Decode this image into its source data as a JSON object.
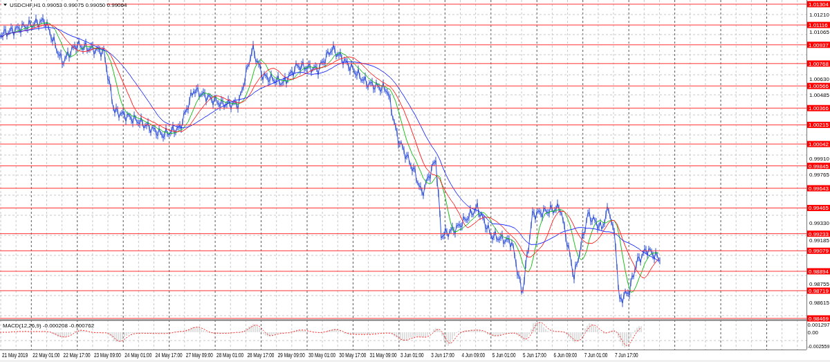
{
  "header": {
    "symbol": "USDCHF,H1",
    "quotes": [
      "0.99053",
      "0.99075",
      "0.99050",
      "0.99064"
    ]
  },
  "price_levels": [
    {
      "label": "1.01304"
    },
    {
      "label": "1.01116"
    },
    {
      "label": "1.00937"
    },
    {
      "label": "1.00768"
    },
    {
      "label": "1.00566"
    },
    {
      "label": "1.00366"
    },
    {
      "label": "1.00215"
    },
    {
      "label": "1.00042"
    },
    {
      "label": "0.99845"
    },
    {
      "label": "0.99643"
    },
    {
      "label": "0.99465"
    },
    {
      "label": "0.99233"
    },
    {
      "label": "0.99079"
    },
    {
      "label": "0.98894"
    },
    {
      "label": "0.98719"
    },
    {
      "label": "0.98469"
    }
  ],
  "price_ticks": [
    "1.01210",
    "1.01065",
    "1.00630",
    "1.00485",
    "0.99910",
    "0.99765",
    "0.99330",
    "0.99185",
    "0.98755",
    "0.98615"
  ],
  "indicator": {
    "label": "MACD(12,26,9) -0.000208 -0.000762",
    "ticks": [
      "0.001297",
      "0.00",
      "-0.002559"
    ]
  },
  "time_labels": [
    "21 May 2019",
    "22 May 01:00",
    "22 May 17:00",
    "23 May 09:00",
    "24 May 01:00",
    "24 May 17:00",
    "27 May 09:00",
    "28 May 01:00",
    "28 May 17:00",
    "29 May 09:00",
    "30 May 01:00",
    "30 May 17:00",
    "31 May 09:00",
    "3 Jun 01:00",
    "3 Jun 17:00",
    "4 Jun 09:00",
    "5 Jun 01:00",
    "5 Jun 17:00",
    "6 Jun 09:00",
    "7 Jun 01:00",
    "7 Jun 17:00"
  ]
}
